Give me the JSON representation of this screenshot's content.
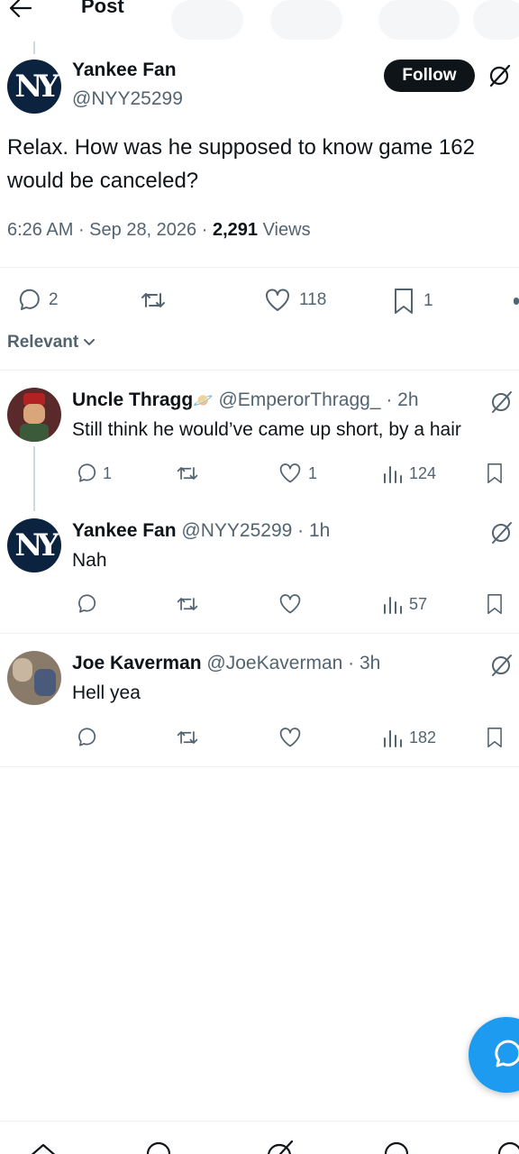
{
  "header": {
    "title": "Post"
  },
  "main_post": {
    "name": "Yankee Fan",
    "handle": "@NYY25299",
    "follow_label": "Follow",
    "text": "Relax. How was he supposed to know game 162 would be canceled?",
    "time": "6:26 AM",
    "date": "Sep 28, 2026",
    "views_count": "2,291",
    "views_label": "Views",
    "replies": "2",
    "likes": "118",
    "bookmarks": "1"
  },
  "sort": {
    "label": "Relevant"
  },
  "replies": [
    {
      "name": "Uncle Thragg",
      "handle": "@EmperorThragg_",
      "time": "· 2h",
      "text": "Still think he would’ve came up short, by a hair",
      "replies": "1",
      "likes": "1",
      "views": "124"
    },
    {
      "name": "Yankee Fan",
      "handle": "@NYY25299",
      "time": "· 1h",
      "text": "Nah",
      "views": "57"
    },
    {
      "name": "Joe Kaverman",
      "handle": "@JoeKaverman",
      "time": "· 3h",
      "text": "Hell yea",
      "views": "182"
    }
  ],
  "colors": {
    "accent": "#1d9bf0",
    "text": "#0f1419",
    "muted": "#536471",
    "yankees_navy": "#0c2340"
  }
}
